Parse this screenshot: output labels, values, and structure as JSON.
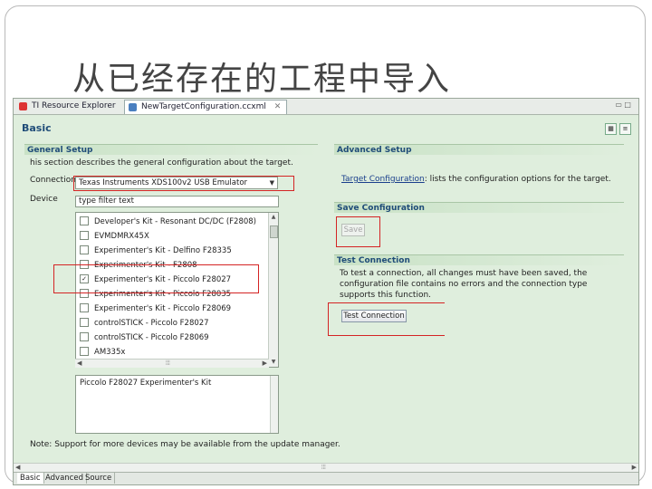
{
  "slide": {
    "title": "从已经存在的工程中导入"
  },
  "tabs": [
    {
      "label": "TI Resource Explorer"
    },
    {
      "label": "NewTargetConfiguration.ccxml",
      "close": "✕"
    }
  ],
  "window_buttons": "▭ □",
  "page": {
    "title": "Basic"
  },
  "general_setup": {
    "heading": "General Setup",
    "description": "his section describes the general configuration about the target.",
    "connection_label": "Connection",
    "connection_value": "Texas Instruments XDS100v2 USB Emulator",
    "device_label": "Device",
    "device_filter_placeholder": "type filter text",
    "devices": [
      {
        "label": "Developer's Kit - Resonant DC/DC (F2808)",
        "checked": false
      },
      {
        "label": "EVMDMRX45X",
        "checked": false
      },
      {
        "label": "Experimenter's Kit - Delfino F28335",
        "checked": false
      },
      {
        "label": "Experimenter's Kit - F2808",
        "checked": false
      },
      {
        "label": "Experimenter's Kit - Piccolo F28027",
        "checked": true
      },
      {
        "label": "Experimenter's Kit - Piccolo F28035",
        "checked": false
      },
      {
        "label": "Experimenter's Kit - Piccolo F28069",
        "checked": false
      },
      {
        "label": "controlSTICK - Piccolo F28027",
        "checked": false
      },
      {
        "label": "controlSTICK - Piccolo F28069",
        "checked": false
      },
      {
        "label": "AM335x",
        "checked": false
      }
    ],
    "device_description": "Piccolo F28027 Experimenter's Kit",
    "note": "Note: Support for more devices may be available from the update manager."
  },
  "advanced_setup": {
    "heading": "Advanced Setup",
    "link_text": "Target Configuration",
    "link_suffix": ": lists the configuration options for the target."
  },
  "save_configuration": {
    "heading": "Save Configuration",
    "button": "Save"
  },
  "test_connection": {
    "heading": "Test Connection",
    "description": "To test a connection, all changes must have been saved, the configuration file contains no errors and the connection type supports this function.",
    "button": "Test Connection"
  },
  "bottom_tabs": [
    {
      "label": "Basic"
    },
    {
      "label": "Advanced"
    },
    {
      "label": "Source"
    }
  ],
  "colors": {
    "highlight": "#d42424",
    "panel_bg": "#dfeedd",
    "section_title": "#1f4c78"
  }
}
